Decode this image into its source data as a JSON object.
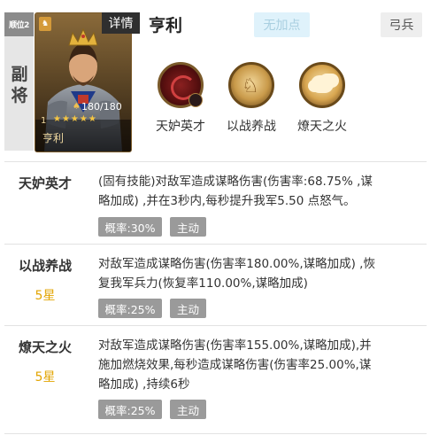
{
  "header": {
    "slot_tag": "顺位2",
    "role": "副将",
    "detail_label": "详情",
    "hero_name": "亨利",
    "no_bonus_label": "无加点",
    "troop_type": "弓兵"
  },
  "card": {
    "level": "1",
    "hp": "180/180",
    "stars": "★★★★★",
    "name": "亨利"
  },
  "skills_top": [
    {
      "name": "天妒英才",
      "icon": "red-swirl-icon"
    },
    {
      "name": "以战养战",
      "icon": "horse-icon"
    },
    {
      "name": "燎天之火",
      "icon": "fire-cloud-icon"
    }
  ],
  "skills": [
    {
      "name": "天妒英才",
      "star": "",
      "lines": [
        "(固有技能)对敌军造成谋略伤害(伤害率:68.75% ,谋",
        "略加成) ,并在3秒内,每秒提升我军5.50 点怒气。"
      ],
      "prob": "概率:30%",
      "type": "主动"
    },
    {
      "name": "以战养战",
      "star": "5星",
      "lines": [
        "对敌军造成谋略伤害(伤害率180.00%,谋略加成) ,恢",
        "复我军兵力(恢复率110.00%,谋略加成)"
      ],
      "prob": "概率:25%",
      "type": "主动"
    },
    {
      "name": "燎天之火",
      "star": "5星",
      "lines": [
        "对敌军造成谋略伤害(伤害率155.00%,谋略加成),并",
        "施加燃烧效果,每秒造成谋略伤害(伤害率25.00%,谋",
        "略加成) ,持续6秒"
      ],
      "prob": "概率:25%",
      "type": "主动"
    }
  ]
}
